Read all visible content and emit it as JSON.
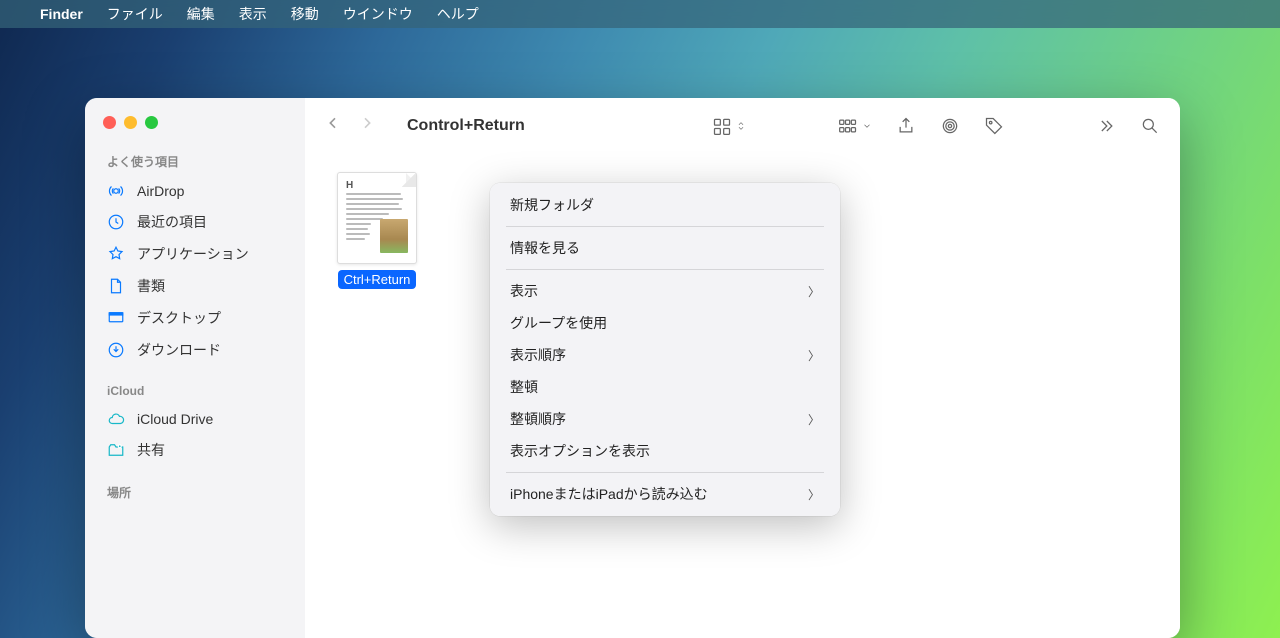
{
  "menubar": {
    "app": "Finder",
    "items": [
      "ファイル",
      "編集",
      "表示",
      "移動",
      "ウインドウ",
      "ヘルプ"
    ]
  },
  "sidebar": {
    "sections": [
      {
        "header": "よく使う項目",
        "items": [
          {
            "icon": "airdrop",
            "label": "AirDrop"
          },
          {
            "icon": "clock",
            "label": "最近の項目"
          },
          {
            "icon": "apps",
            "label": "アプリケーション"
          },
          {
            "icon": "doc",
            "label": "書類"
          },
          {
            "icon": "desktop",
            "label": "デスクトップ"
          },
          {
            "icon": "download",
            "label": "ダウンロード"
          }
        ]
      },
      {
        "header": "iCloud",
        "items": [
          {
            "icon": "cloud",
            "label": "iCloud Drive"
          },
          {
            "icon": "folder-shared",
            "label": "共有"
          }
        ]
      },
      {
        "header": "場所",
        "items": []
      }
    ]
  },
  "toolbar": {
    "title": "Control+Return"
  },
  "file": {
    "name": "Ctrl+Return"
  },
  "context_menu": {
    "groups": [
      [
        {
          "label": "新規フォルダ",
          "submenu": false
        }
      ],
      [
        {
          "label": "情報を見る",
          "submenu": false
        }
      ],
      [
        {
          "label": "表示",
          "submenu": true
        },
        {
          "label": "グループを使用",
          "submenu": false
        },
        {
          "label": "表示順序",
          "submenu": true
        },
        {
          "label": "整頓",
          "submenu": false
        },
        {
          "label": "整頓順序",
          "submenu": true
        },
        {
          "label": "表示オプションを表示",
          "submenu": false
        }
      ],
      [
        {
          "label": "iPhoneまたはiPadから読み込む",
          "submenu": true
        }
      ]
    ]
  }
}
